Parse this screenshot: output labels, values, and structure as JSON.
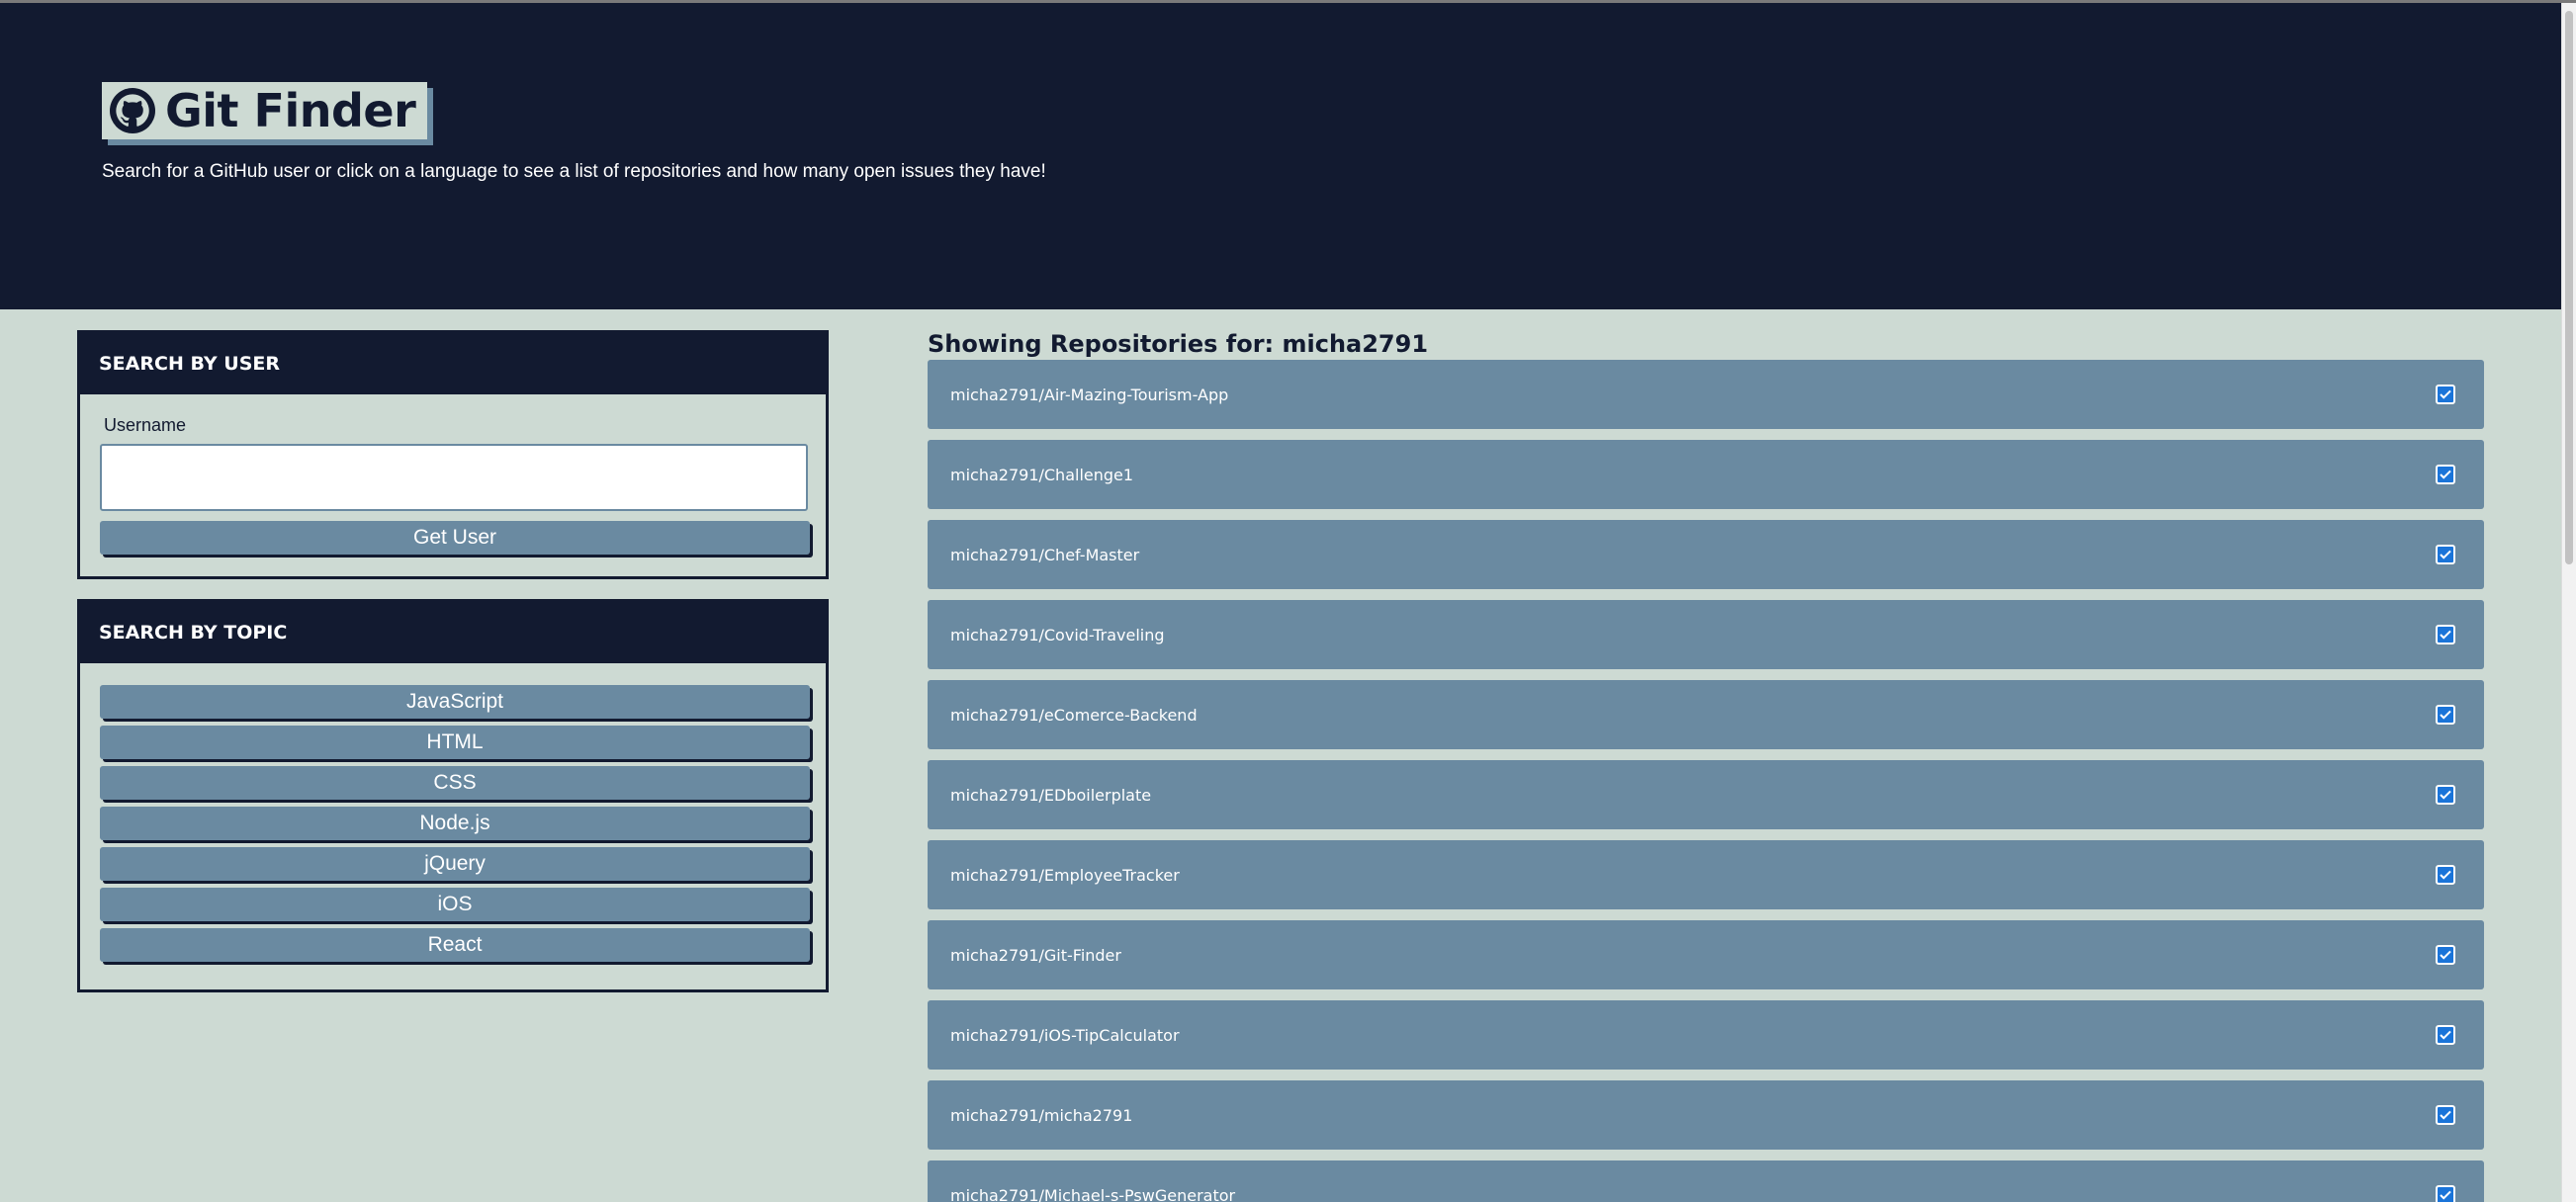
{
  "header": {
    "title": "Git Finder",
    "logo_icon": "github-icon",
    "tagline": "Search for a GitHub user or click on a language to see a list of repositories and how many open issues they have!"
  },
  "user_search": {
    "heading": "SEARCH BY USER",
    "label": "Username",
    "value": "",
    "placeholder": "",
    "button": "Get User"
  },
  "topic_search": {
    "heading": "SEARCH BY TOPIC",
    "topics": [
      "JavaScript",
      "HTML",
      "CSS",
      "Node.js",
      "jQuery",
      "iOS",
      "React"
    ]
  },
  "results": {
    "title": "Showing Repositories for: micha2791",
    "status_icon": "check-icon",
    "repos": [
      "micha2791/Air-Mazing-Tourism-App",
      "micha2791/Challenge1",
      "micha2791/Chef-Master",
      "micha2791/Covid-Traveling",
      "micha2791/eComerce-Backend",
      "micha2791/EDboilerplate",
      "micha2791/EmployeeTracker",
      "micha2791/Git-Finder",
      "micha2791/iOS-TipCalculator",
      "micha2791/micha2791",
      "micha2791/Michael-s-PswGenerator"
    ]
  },
  "colors": {
    "navy": "#121a30",
    "sage": "#cddad3",
    "slate": "#6a8aa1",
    "check_blue": "#1a74d9"
  }
}
